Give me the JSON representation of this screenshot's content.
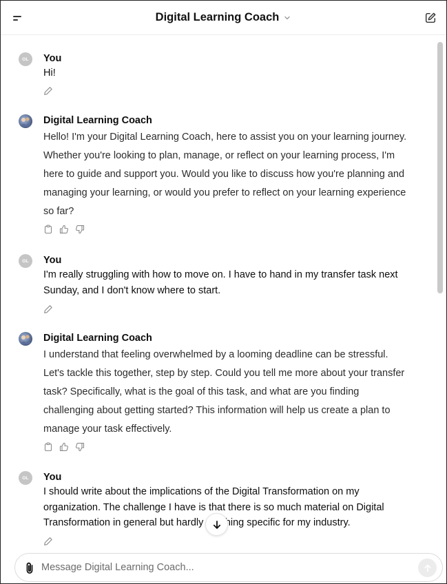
{
  "header": {
    "title": "Digital Learning Coach",
    "menu_icon": "sidebar-menu-icon",
    "chevron_icon": "chevron-down-icon",
    "edit_icon": "new-chat-icon"
  },
  "messages": [
    {
      "role": "user",
      "avatar_initials": "OL",
      "author": "You",
      "lines": [
        "Hi!"
      ]
    },
    {
      "role": "assistant",
      "author": "Digital Learning Coach",
      "lines": [
        "Hello! I'm your Digital Learning Coach, here to assist you on your learning journey.",
        "Whether you're looking to plan, manage, or reflect on your learning process, I'm",
        "here to guide and support you. Would you like to discuss how you're planning and",
        "managing your learning, or would you prefer to reflect on your learning experience",
        "so far?"
      ]
    },
    {
      "role": "user",
      "avatar_initials": "OL",
      "author": "You",
      "lines": [
        "I'm really struggling with how to move on. I have to hand in my transfer task next",
        "Sunday, and I don't know where to start."
      ]
    },
    {
      "role": "assistant",
      "author": "Digital Learning Coach",
      "lines": [
        "I understand that feeling overwhelmed by a looming deadline can be stressful.",
        "Let's tackle this together, step by step. Could you tell me more about your transfer",
        "task? Specifically, what is the goal of this task, and what are you finding",
        "challenging about getting started? This information will help us create a plan to",
        "manage your task effectively."
      ]
    },
    {
      "role": "user",
      "avatar_initials": "OL",
      "author": "You",
      "lines": [
        "I should write about the implications of the Digital Transformation on my",
        "organization. The challenge I have is that there is so much material on Digital",
        "Transformation in general but hardly anything specific for my industry."
      ]
    }
  ],
  "composer": {
    "placeholder": "Message Digital Learning Coach...",
    "value": ""
  }
}
